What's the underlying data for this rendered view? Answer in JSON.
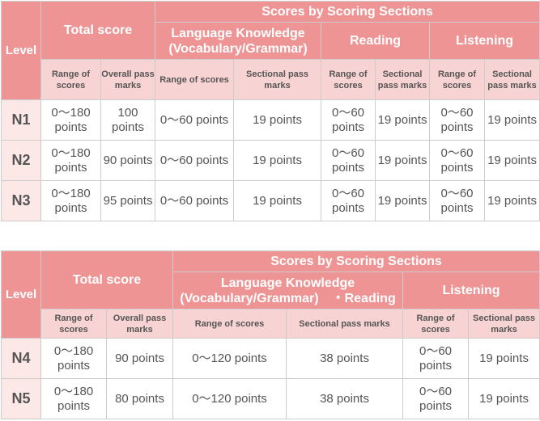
{
  "table1": {
    "level_header": "Level",
    "total_header": "Total score",
    "sections_header": "Scores by Scoring Sections",
    "section_headers": [
      "Language Knowledge (Vocabulary/Grammar)",
      "Reading",
      "Listening"
    ],
    "lk_line1": "Language Knowledge",
    "lk_line2": "(Vocabulary/Grammar)",
    "subheaders": {
      "total_range": "Range of scores",
      "total_pass": "Overall pass marks",
      "lk_range": "Range of scores",
      "lk_pass": "Sectional pass marks",
      "rd_range": "Range of scores",
      "rd_pass": "Sectional pass marks",
      "ls_range": "Range of scores",
      "ls_pass": "Sectional pass marks"
    },
    "rows": [
      {
        "level": "N1",
        "total_range": "0〜180 points",
        "total_pass": "100 points",
        "lk_range": "0〜60 points",
        "lk_pass": "19 points",
        "rd_range": "0〜60 points",
        "rd_pass": "19 points",
        "ls_range": "0〜60 points",
        "ls_pass": "19 points"
      },
      {
        "level": "N2",
        "total_range": "0〜180 points",
        "total_pass": "90 points",
        "lk_range": "0〜60 points",
        "lk_pass": "19 points",
        "rd_range": "0〜60 points",
        "rd_pass": "19 points",
        "ls_range": "0〜60 points",
        "ls_pass": "19 points"
      },
      {
        "level": "N3",
        "total_range": "0〜180 points",
        "total_pass": "95 points",
        "lk_range": "0〜60 points",
        "lk_pass": "19 points",
        "rd_range": "0〜60 points",
        "rd_pass": "19 points",
        "ls_range": "0〜60 points",
        "ls_pass": "19 points"
      }
    ]
  },
  "table2": {
    "level_header": "Level",
    "total_header": "Total score",
    "sections_header": "Scores by Scoring Sections",
    "lkr_line1": "Language Knowledge",
    "lkr_line2": "(Vocabulary/Grammar)　・Reading",
    "listening_header": "Listening",
    "subheaders": {
      "total_range": "Range of scores",
      "total_pass": "Overall pass marks",
      "lkr_range": "Range of scores",
      "lkr_pass": "Sectional pass marks",
      "ls_range": "Range of scores",
      "ls_pass": "Sectional pass marks"
    },
    "rows": [
      {
        "level": "N4",
        "total_range": "0〜180 points",
        "total_pass": "90 points",
        "lkr_range": "0〜120 points",
        "lkr_pass": "38 points",
        "ls_range": "0〜60 points",
        "ls_pass": "19 points"
      },
      {
        "level": "N5",
        "total_range": "0〜180 points",
        "total_pass": "80 points",
        "lkr_range": "0〜120 points",
        "lkr_pass": "38 points",
        "ls_range": "0〜60 points",
        "ls_pass": "19 points"
      }
    ]
  }
}
